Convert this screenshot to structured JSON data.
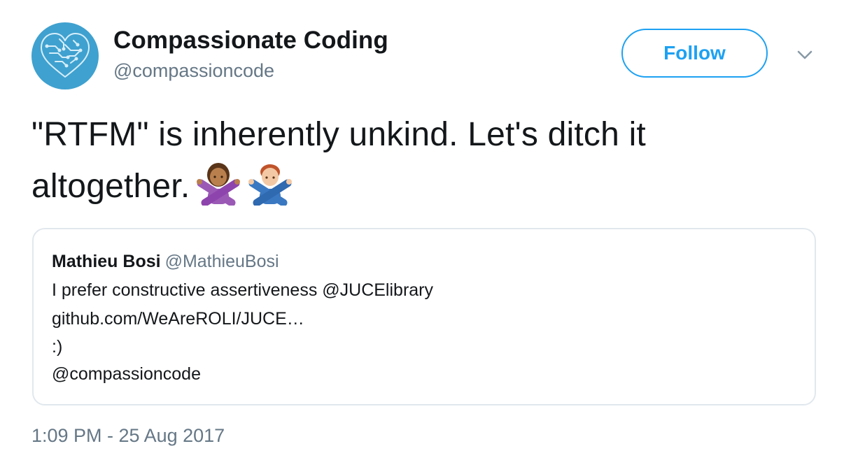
{
  "author": {
    "name": "Compassionate Coding",
    "handle": "@compassioncode",
    "avatar_icon": "circuit-heart-logo",
    "avatar_color": "#3fa1cf"
  },
  "follow_button": {
    "label": "Follow",
    "color": "#1da1f2"
  },
  "menu_icon": "chevron-down-icon",
  "tweet": {
    "text_line1": "\"RTFM\" is inherently unkind. Let's ditch it",
    "text_line2": "altogether.",
    "emojis": [
      "woman-gesturing-no",
      "man-gesturing-no"
    ]
  },
  "quoted_tweet": {
    "name": "Mathieu Bosi",
    "handle": "@MathieuBosi",
    "lines": [
      "I prefer constructive assertiveness @JUCElibrary",
      "github.com/WeAreROLI/JUCE…",
      ":)",
      "@compassioncode"
    ]
  },
  "timestamp": "1:09 PM - 25 Aug 2017",
  "colors": {
    "text": "#14171a",
    "secondary": "#657786",
    "border": "#e1e8ed"
  }
}
